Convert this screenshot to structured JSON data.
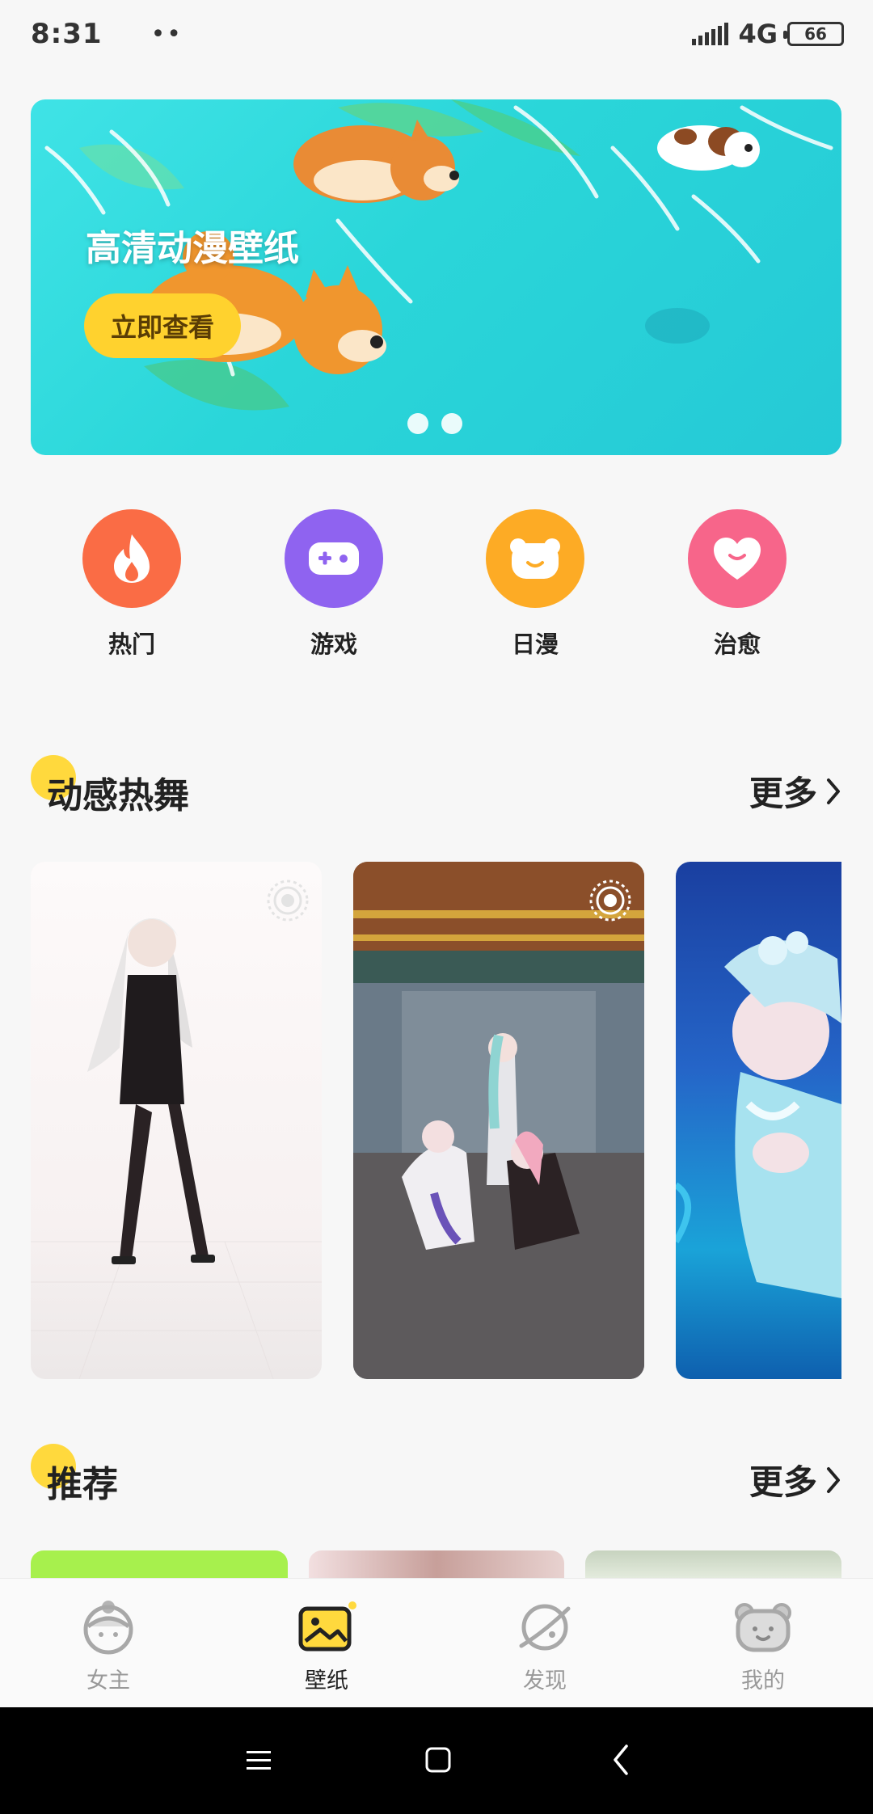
{
  "status_bar": {
    "time": "8:31",
    "dots": "••",
    "network": "4G",
    "battery": "66"
  },
  "banner": {
    "title": "高清动漫壁纸",
    "button_label": "立即查看",
    "page_count": 2
  },
  "categories": [
    {
      "label": "热门",
      "icon": "flame-icon",
      "color": "#fa6c45"
    },
    {
      "label": "游戏",
      "icon": "gamepad-icon",
      "color": "#8f63f0"
    },
    {
      "label": "日漫",
      "icon": "bear-icon",
      "color": "#fdab25"
    },
    {
      "label": "治愈",
      "icon": "heart-icon",
      "color": "#f7658a"
    }
  ],
  "sections": {
    "dance": {
      "title": "动感热舞",
      "more_label": "更多"
    },
    "recommend": {
      "title": "推荐",
      "more_label": "更多"
    }
  },
  "tabbar": {
    "tabs": [
      {
        "label": "女主",
        "icon": "girl-face-icon",
        "active": false
      },
      {
        "label": "壁纸",
        "icon": "wallpaper-icon",
        "active": true
      },
      {
        "label": "发现",
        "icon": "planet-icon",
        "active": false
      },
      {
        "label": "我的",
        "icon": "bear-face-icon",
        "active": false
      }
    ]
  },
  "colors": {
    "accent_yellow": "#ffd93d",
    "banner_button": "#ffd22e",
    "background": "#f7f7f7"
  }
}
